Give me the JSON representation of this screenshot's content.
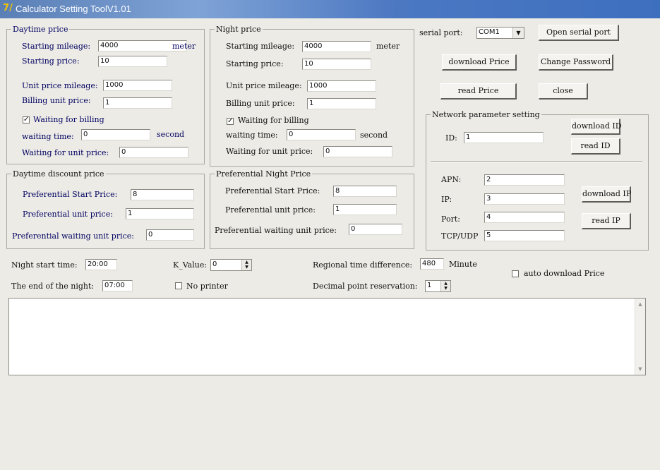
{
  "window": {
    "title": "Calculator Setting ToolV1.01",
    "icon": "calculator-app-icon",
    "icon_glyph": "7/"
  },
  "daytime": {
    "title": "Daytime price",
    "starting_mileage_label": "Starting mileage:",
    "starting_mileage": "4000",
    "unit": "meter",
    "starting_price_label": "Starting price:",
    "starting_price": "10",
    "unit_price_mileage_label": "Unit price mileage:",
    "unit_price_mileage": "1000",
    "billing_unit_price_label": "Billing unit price:",
    "billing_unit_price": "1",
    "waiting_billing_label": "Waiting for billing",
    "waiting_billing_checked": true,
    "waiting_time_label": "waiting time:",
    "waiting_time": "0",
    "second": "second",
    "waiting_unit_price_label": "Waiting for unit price:",
    "waiting_unit_price": "0"
  },
  "night": {
    "title": "Night price",
    "starting_mileage_label": "Starting mileage:",
    "starting_mileage": "4000",
    "unit": "meter",
    "starting_price_label": "Starting price:",
    "starting_price": "10",
    "unit_price_mileage_label": "Unit price mileage:",
    "unit_price_mileage": "1000",
    "billing_unit_price_label": "Billing unit price:",
    "billing_unit_price": "1",
    "waiting_billing_label": "Waiting for billing",
    "waiting_billing_checked": true,
    "waiting_time_label": "waiting time:",
    "waiting_time": "0",
    "second": "second",
    "waiting_unit_price_label": "Waiting for unit price:",
    "waiting_unit_price": "0"
  },
  "day_discount": {
    "title": "Daytime discount price",
    "start_price_label": "Preferential Start Price:",
    "start_price": "8",
    "unit_price_label": "Preferential unit price:",
    "unit_price": "1",
    "waiting_unit_label": "Preferential waiting unit price:",
    "waiting_unit": "0"
  },
  "night_discount": {
    "title": "Preferential Night Price",
    "start_price_label": "Preferential Start Price:",
    "start_price": "8",
    "unit_price_label": "Preferential unit price:",
    "unit_price": "1",
    "waiting_unit_label": "Preferential waiting unit price:",
    "waiting_unit": "0"
  },
  "serial": {
    "port_label": "serial port:",
    "port_value": "COM1",
    "open_button": "Open serial port",
    "download_price_button": "download Price",
    "change_password_button": "Change Password",
    "read_price_button": "read Price",
    "close_button": "close"
  },
  "network": {
    "title": "Network parameter setting",
    "id_label": "ID:",
    "id_value": "1",
    "download_id_button": "download ID",
    "read_id_button": "read ID",
    "apn_label": "APN:",
    "apn_value": "2",
    "ip_label": "IP:",
    "ip_value": "3",
    "port_label": "Port:",
    "port_value": "4",
    "tcpudp_label": "TCP/UDP",
    "tcpudp_value": "5",
    "download_ip_button": "download IP",
    "read_ip_button": "read IP"
  },
  "bottom": {
    "night_start_label": "Night start time:",
    "night_start": "20:00",
    "night_end_label": "The end of the night:",
    "night_end": "07:00",
    "k_value_label": "K_Value:",
    "k_value": "0",
    "no_printer_label": "No printer",
    "no_printer_checked": false,
    "regional_label": "Regional time difference:",
    "regional_value": "480",
    "minute": "Minute",
    "decimal_label": "Decimal point reservation:",
    "decimal_value": "1",
    "auto_download_label": "auto download Price",
    "auto_download_checked": false
  },
  "log": {
    "content": ""
  }
}
